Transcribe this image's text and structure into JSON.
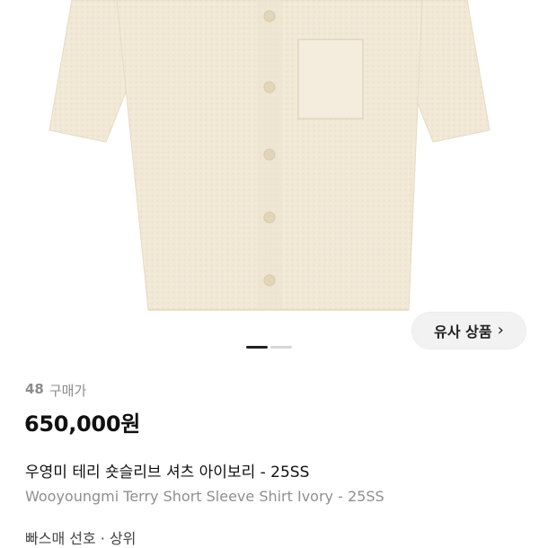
{
  "similar_products": {
    "label": "유사 상품",
    "chevron": "›"
  },
  "pager": {
    "total": 2,
    "active_index": 0
  },
  "purchase_meta": {
    "count": "48",
    "label": "구매가"
  },
  "price": "650,000원",
  "title_ko": "우영미 테리 숏슬리브 셔츠 아이보리 - 25SS",
  "title_en": "Wooyoungmi Terry Short Sleeve Shirt Ivory - 25SS",
  "shipping_text": "빠스매 선호 · 상위",
  "colors": {
    "shirt": "#f1e8d6",
    "price_text": "#111111",
    "muted_text": "#8c8c8c"
  }
}
